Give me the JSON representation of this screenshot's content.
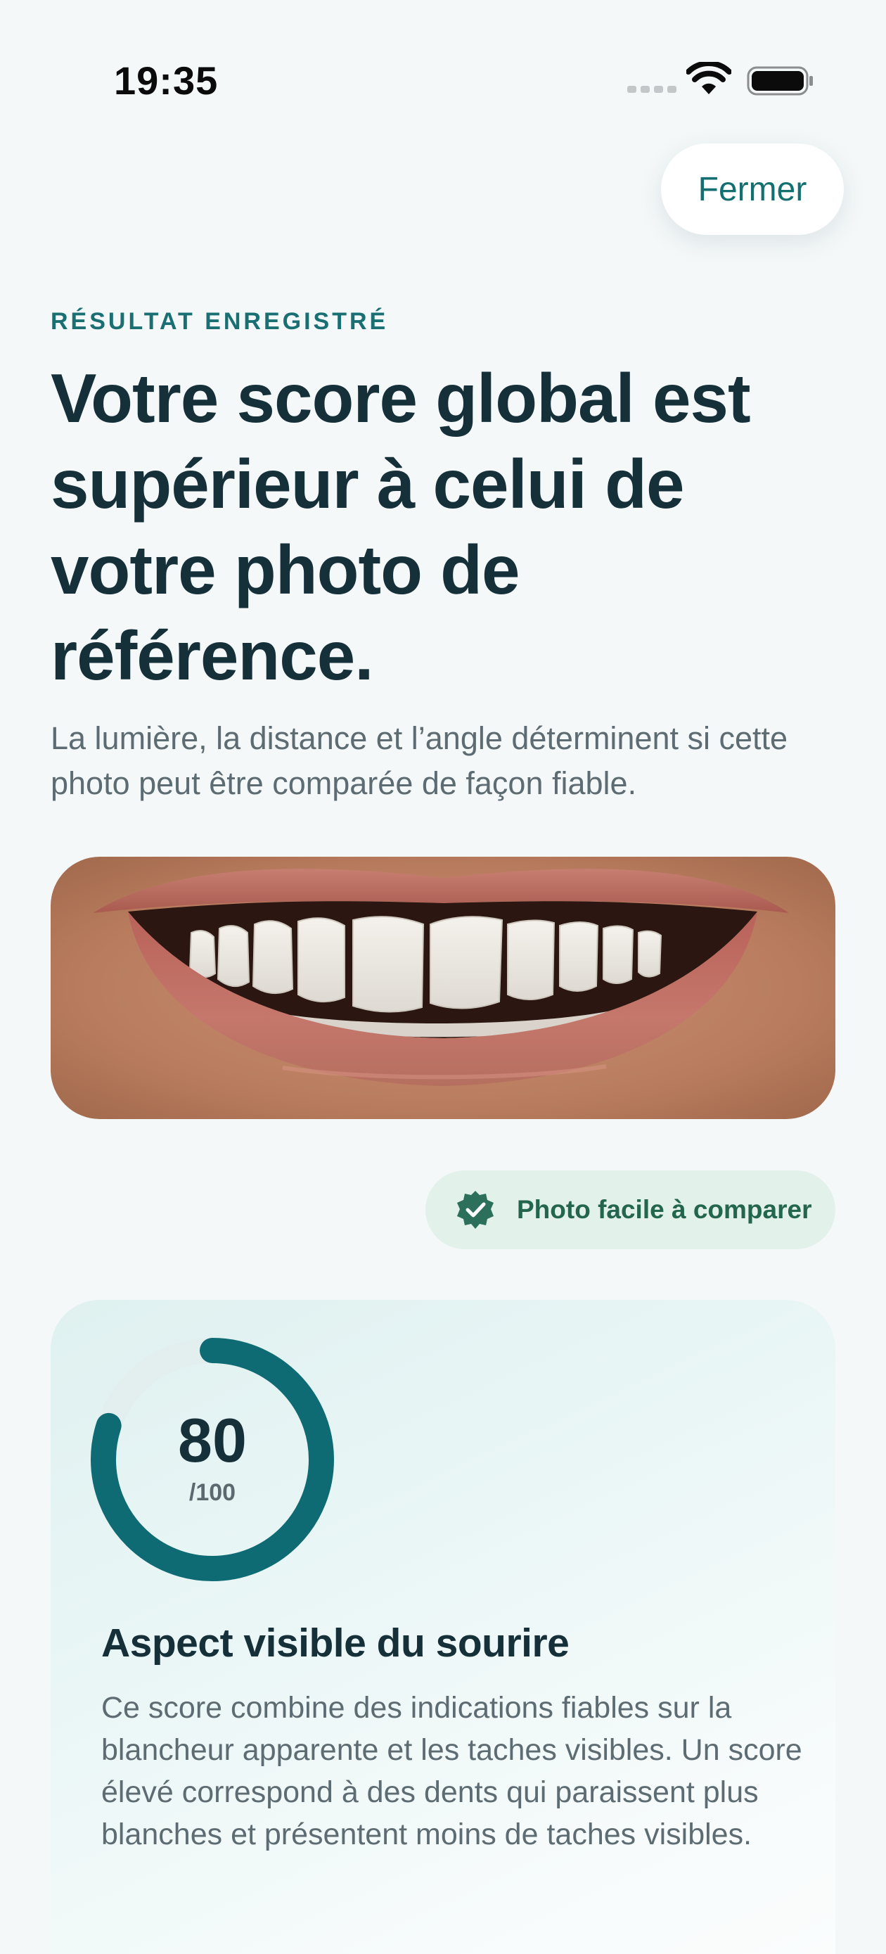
{
  "status_bar": {
    "time": "19:35",
    "icons": [
      "cellular-signal-icon",
      "wifi-icon",
      "battery-icon"
    ]
  },
  "header": {
    "close_label": "Fermer"
  },
  "result": {
    "eyebrow": "RÉSULTAT ENREGISTRÉ",
    "headline": "Votre score global est supérieur à celui de votre photo de référence.",
    "subtitle": "La lumière, la distance et l’angle déterminent si cette photo peut être comparée de façon fiable."
  },
  "photo": {
    "subject": "smile close-up"
  },
  "badge": {
    "icon": "verified-check-icon",
    "label": "Photo facile à comparer"
  },
  "score_card": {
    "score": "80",
    "score_max": "/100",
    "score_fraction": 0.8,
    "title": "Aspect visible du sourire",
    "description": "Ce score combine des indications fiables sur la blancheur apparente et les taches visibles. Un score élevé correspond à des dents qui paraissent plus blanches et présentent moins de taches visibles."
  },
  "colors": {
    "accent": "#146f70",
    "ring": "#0e6b73",
    "badge_background": "#e2f1ea",
    "badge_text": "#24654f",
    "heading": "#16303a",
    "body_text": "#5d6c72",
    "background": "#f4f8f9"
  }
}
